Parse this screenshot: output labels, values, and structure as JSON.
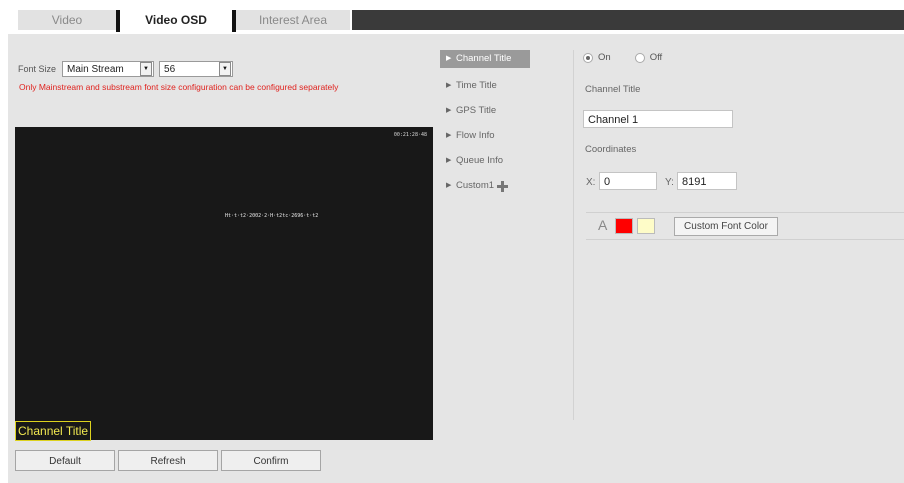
{
  "tabs": [
    {
      "label": "Video"
    },
    {
      "label": "Video OSD"
    },
    {
      "label": "Interest Area"
    }
  ],
  "font_size": {
    "label": "Font Size",
    "stream_select": "Main Stream",
    "size_select": "56"
  },
  "warning": "Only Mainstream and substream font size configuration can be configured separately",
  "video": {
    "timestamp": "00:21:28·48",
    "overlay_text": "Ht·t·t2·2002·2·H·t2tc·2696·t·t2",
    "channel_title_overlay": "Channel Title"
  },
  "buttons": {
    "default": "Default",
    "refresh": "Refresh",
    "confirm": "Confirm"
  },
  "nav": [
    {
      "label": "Channel Title"
    },
    {
      "label": "Time Title"
    },
    {
      "label": "GPS Title"
    },
    {
      "label": "Flow Info"
    },
    {
      "label": "Queue Info"
    },
    {
      "label": "Custom1"
    }
  ],
  "settings": {
    "on_label": "On",
    "off_label": "Off",
    "channel_title_label": "Channel Title",
    "channel_title_value": "Channel 1",
    "coordinates_label": "Coordinates",
    "x_label": "X:",
    "x_value": "0",
    "y_label": "Y:",
    "y_value": "8191",
    "font_icon_glyph": "A",
    "custom_font_color_label": "Custom Font Color",
    "swatch_1_color": "#ff0000",
    "swatch_2_color": "#fefcc8"
  }
}
